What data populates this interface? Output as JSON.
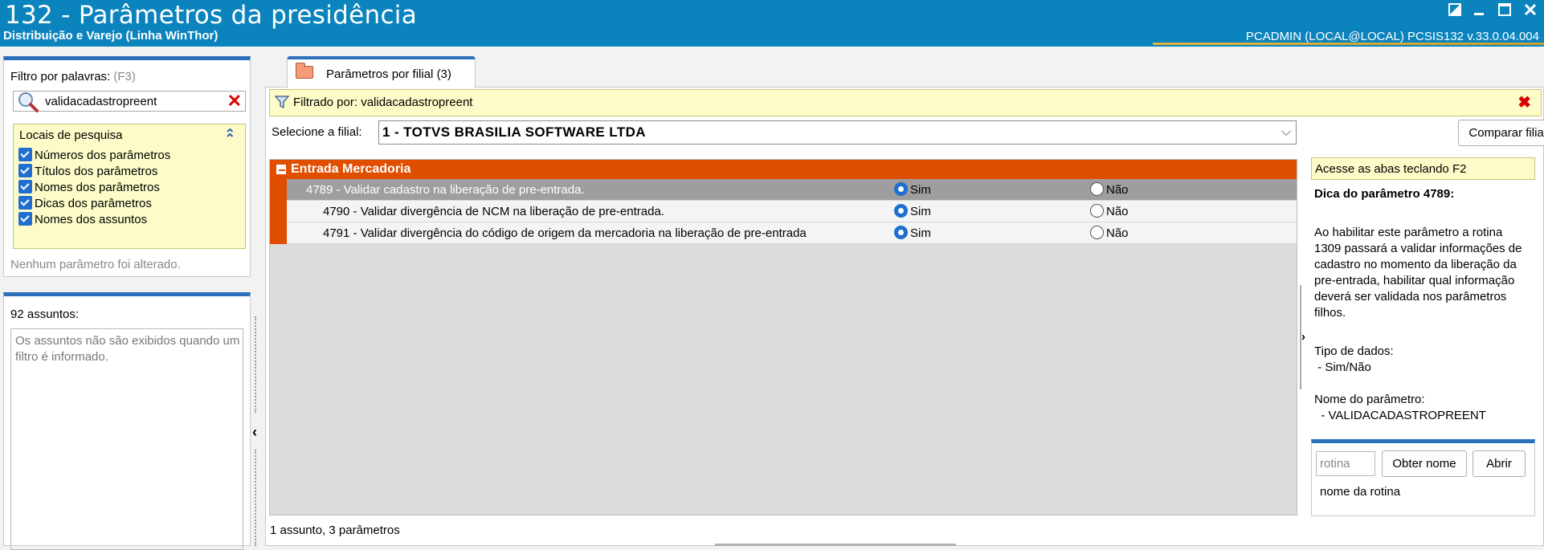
{
  "window": {
    "title": "132 - Parâmetros da presidência",
    "subtitle": "Distribuição e Varejo (Linha WinThor)",
    "user_info": "PCADMIN (LOCAL@LOCAL)   PCSIS132  v.33.0.04.004"
  },
  "filter": {
    "label": "Filtro por palavras:",
    "shortcut": "(F3)",
    "value": "validacadastropreent"
  },
  "locations": {
    "header": "Locais de pesquisa",
    "items": [
      {
        "label": "Números dos parâmetros",
        "checked": true
      },
      {
        "label": "Títulos dos parâmetros",
        "checked": true
      },
      {
        "label": "Nomes dos parâmetros",
        "checked": true
      },
      {
        "label": "Dicas dos parâmetros",
        "checked": true
      },
      {
        "label": "Nomes dos assuntos",
        "checked": true
      }
    ],
    "status": "Nenhum parâmetro foi alterado."
  },
  "subjects": {
    "count_label": "92 assuntos:",
    "note": "Os assuntos não são exibidos quando um filtro é informado."
  },
  "tab": {
    "label": "Parâmetros por filial",
    "count": "(3)"
  },
  "filter_bar": {
    "text": "Filtrado por: validacadastropreent"
  },
  "branch": {
    "label": "Selecione a filial:",
    "value": "1 - TOTVS BRASILIA SOFTWARE LTDA",
    "compare_button": "Comparar filiais"
  },
  "grid": {
    "group": "Entrada Mercadoria",
    "rows": [
      {
        "text": "4789 - Validar cadastro na liberação de pre-entrada.",
        "yes": "Sim",
        "no": "Não",
        "value": "Sim",
        "selected": true
      },
      {
        "text": "4790 - Validar divergência de NCM na liberação de pre-entrada.",
        "yes": "Sim",
        "no": "Não",
        "value": "Sim",
        "selected": false
      },
      {
        "text": "4791 - Validar divergência do código de origem da mercadoria na liberação de pre-entrada",
        "yes": "Sim",
        "no": "Não",
        "value": "Sim",
        "selected": false
      }
    ]
  },
  "status_bar": "1 assunto, 3 parâmetros",
  "tips": {
    "hint": "Acesse as abas teclando F2",
    "title": "Dica do parâmetro 4789:",
    "body": "Ao habilitar este parâmetro a rotina 1309 passará a validar informações de cadastro no momento da liberação da pre-entrada, habilitar qual informação deverá ser validada nos parâmetros filhos.",
    "data_type_label": "Tipo de dados:",
    "data_type_value": " - Sim/Não",
    "param_name_label": "Nome do parâmetro:",
    "param_name_value": "  - VALIDACADASTROPREENT"
  },
  "routine": {
    "placeholder": "rotina",
    "get_name_button": "Obter nome",
    "open_button": "Abrir",
    "name_label": "nome da rotina"
  }
}
